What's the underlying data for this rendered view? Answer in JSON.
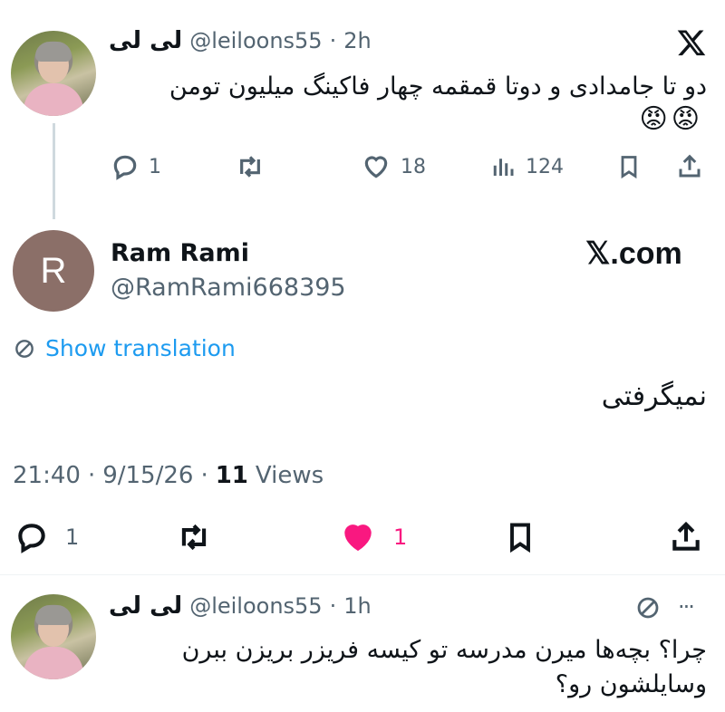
{
  "tweet1": {
    "name": "لی لی",
    "handle": "@leiloons55",
    "separator": "·",
    "time": "2h",
    "text": "دو تا جامدادی و دوتا قمقمه چهار فاکینگ میلیون تومن",
    "emoji": "😡😡",
    "actions": {
      "replies": "1",
      "retweets": "",
      "likes": "18",
      "views": "124"
    }
  },
  "tweet2": {
    "name": "Ram Rami",
    "handle": "@RamRami668395",
    "avatar_letter": "R",
    "brand": "𝕏.com",
    "show_translation": "Show translation",
    "text": "نمیگرفتی",
    "meta_time": "21:40",
    "meta_dot1": "·",
    "meta_date": "9/15/26",
    "meta_dot2": "·",
    "views_count": "11",
    "views_label": "Views",
    "actions": {
      "replies": "1",
      "retweets": "",
      "likes": "1"
    }
  },
  "tweet3": {
    "name": "لی لی",
    "handle": "@leiloons55",
    "separator": "·",
    "time": "1h",
    "text_line1": "چرا؟ بچه‌ها میرن مدرسه تو کیسه فریزر بریزن ببرن",
    "text_line2": "وسایلشون رو؟",
    "more": "···"
  },
  "colors": {
    "like_pink": "#f91880",
    "link_blue": "#1d9bf0",
    "muted": "#536471"
  },
  "icons": [
    "x-logo-icon",
    "reply-icon",
    "retweet-icon",
    "like-icon",
    "views-icon",
    "bookmark-icon",
    "share-icon",
    "translate-icon",
    "more-icon"
  ]
}
